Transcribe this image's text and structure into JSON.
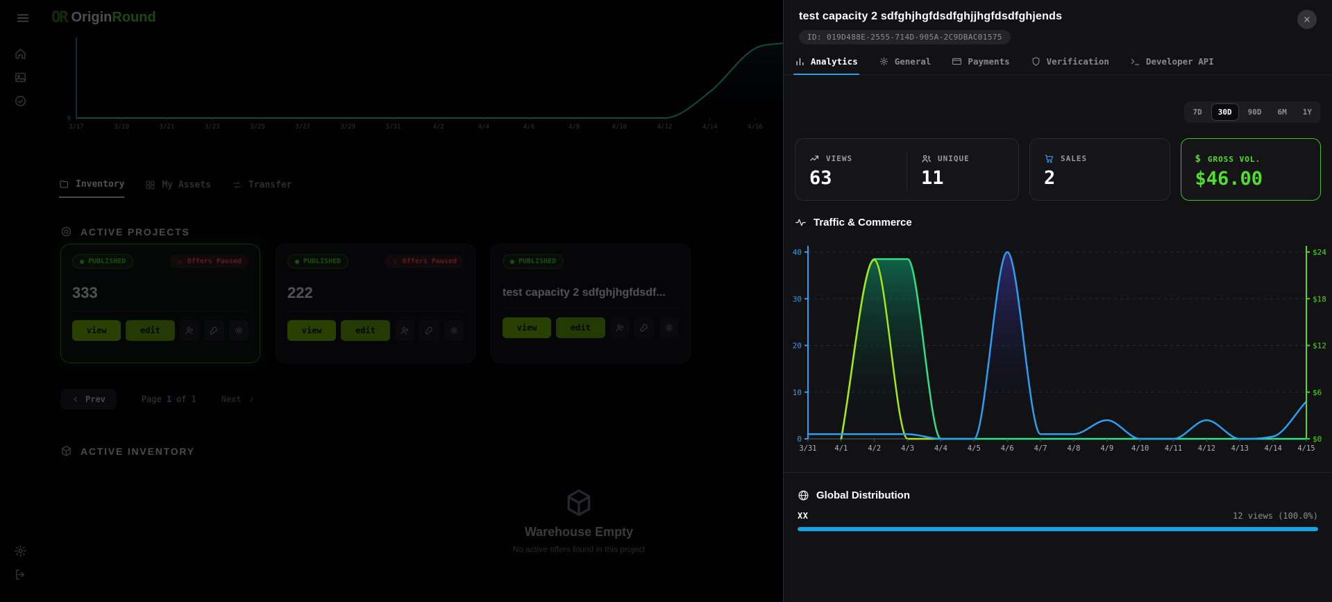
{
  "app": {
    "logo": {
      "glyph": "OR",
      "origin": "Origin",
      "round": "Round"
    }
  },
  "left": {
    "nav_tabs": [
      {
        "label": "Inventory",
        "active": true
      },
      {
        "label": "My Assets",
        "active": false
      },
      {
        "label": "Transfer",
        "active": false
      }
    ],
    "projects_heading": "ACTIVE PROJECTS",
    "cards": [
      {
        "title": "333",
        "status": "PUBLISHED",
        "paused": "Offers Paused",
        "view": "view",
        "edit": "edit",
        "selected": true
      },
      {
        "title": "222",
        "status": "PUBLISHED",
        "paused": "Offers Paused",
        "view": "view",
        "edit": "edit",
        "selected": false
      },
      {
        "title": "test capacity 2 sdfghjhgfdsdf...",
        "status": "PUBLISHED",
        "view": "view",
        "edit": "edit",
        "selected": false
      }
    ],
    "pagination": {
      "prev": "Prev",
      "page_word": "Page",
      "current": "1",
      "of_word": "of",
      "total": "1",
      "next": "Next"
    },
    "inventory_heading": "ACTIVE INVENTORY",
    "empty_title": "Warehouse Empty",
    "empty_subtitle": "No active offers found in this project"
  },
  "panel": {
    "title": "test capacity 2 sdfghjhgfdsdfghjjhgfdsdfghjends",
    "id_label": "ID: 019D488E-2555-714D-905A-2C9DBAC01575",
    "tabs": [
      {
        "label": "Analytics",
        "active": true
      },
      {
        "label": "General",
        "active": false
      },
      {
        "label": "Payments",
        "active": false
      },
      {
        "label": "Verification",
        "active": false
      },
      {
        "label": "Developer API",
        "active": false
      }
    ],
    "ranges": [
      {
        "label": "7D",
        "active": false
      },
      {
        "label": "30D",
        "active": true
      },
      {
        "label": "90D",
        "active": false
      },
      {
        "label": "6M",
        "active": false
      },
      {
        "label": "1Y",
        "active": false
      }
    ],
    "stats": [
      {
        "label": "VIEWS",
        "value": "63"
      },
      {
        "label": "UNIQUE",
        "value": "11"
      },
      {
        "label": "SALES",
        "value": "2"
      },
      {
        "label": "GROSS VOL.",
        "value": "$46.00",
        "dollar_icon": "$"
      }
    ],
    "chart_title": "Traffic & Commerce",
    "distribution": {
      "title": "Global Distribution",
      "region": "XX",
      "stat": "12 views (100.0%)",
      "percent": 100
    }
  },
  "colors": {
    "accent_green": "#4fe02b",
    "accent_blue": "#2b9ff0",
    "emerald_line": "#30e087",
    "lime_line": "#a8e616",
    "right_axis_green": "#52d726",
    "progress_blue": "#14a4e6"
  },
  "chart_data": [
    {
      "type": "area",
      "title": "Traffic & Commerce",
      "x": [
        "3/31",
        "4/1",
        "4/2",
        "4/3",
        "4/4",
        "4/5",
        "4/6",
        "4/7",
        "4/8",
        "4/9",
        "4/10",
        "4/11",
        "4/12",
        "4/13",
        "4/14",
        "4/15"
      ],
      "left_axis": {
        "max": 40,
        "ticks": [
          0,
          10,
          20,
          30,
          40
        ],
        "color": "#2b9ff0"
      },
      "right_axis": {
        "max": 24,
        "ticks": [
          "$0",
          "$6",
          "$12",
          "$18",
          "$24"
        ],
        "color": "#52d726"
      },
      "grid": "dashed-horizontal",
      "legend": "none",
      "series": [
        {
          "name": "unique-area",
          "axis": "left",
          "color": "#30e087",
          "fill": "rgba(16,185,129,0.5)",
          "values": [
            null,
            0,
            38.5,
            38.5,
            0,
            0,
            0,
            0,
            0,
            0,
            0,
            0,
            0,
            0,
            0,
            0
          ]
        },
        {
          "name": "gross-vol-usd",
          "axis": "right",
          "color": "#a8e616",
          "fill": null,
          "values": [
            null,
            0,
            23,
            0,
            0,
            null,
            null,
            null,
            null,
            null,
            null,
            null,
            null,
            null,
            null,
            null
          ]
        },
        {
          "name": "views",
          "axis": "left",
          "color": "#2b9ff0",
          "fill": "rgba(80,70,220,0.45)",
          "values": [
            1,
            1,
            1,
            1,
            0,
            0,
            40,
            1,
            1,
            4,
            0,
            0,
            4,
            0,
            0.5,
            8
          ]
        }
      ]
    },
    {
      "type": "line",
      "title": "background-activity-sparkline",
      "x": [
        "3/17",
        "3/19",
        "3/21",
        "3/23",
        "3/25",
        "3/27",
        "3/29",
        "3/31",
        "4/2",
        "4/4",
        "4/6",
        "4/8",
        "4/10",
        "4/12",
        "4/14",
        "4/16"
      ],
      "ylim": [
        0,
        10
      ],
      "series": [
        {
          "name": "activity",
          "color": "#2fd6a8",
          "fill": "rgba(47,214,168,0.12)",
          "values": [
            0,
            0,
            0,
            0,
            0,
            0,
            0,
            0,
            0,
            0,
            0,
            0,
            0,
            0,
            3.5,
            9.3
          ]
        }
      ]
    }
  ]
}
